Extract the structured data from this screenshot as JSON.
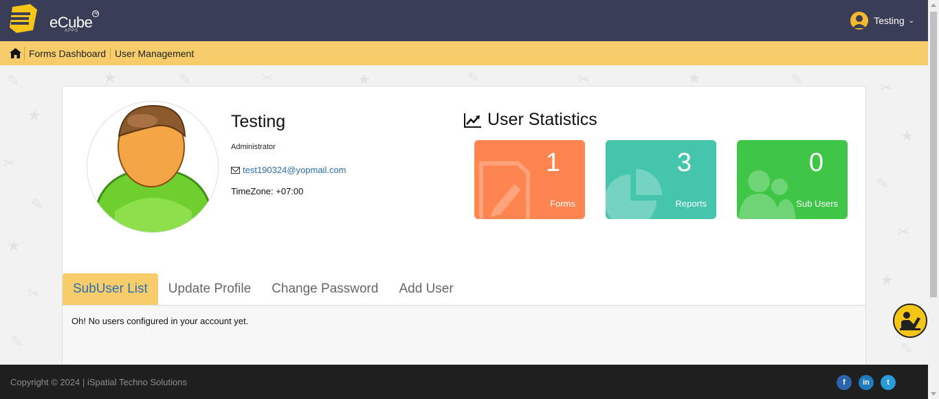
{
  "header": {
    "logo_text": "eCube",
    "logo_sub": "APPS",
    "logo_tm": "TM",
    "user_name": "Testing"
  },
  "nav": {
    "items": [
      {
        "label": "Forms Dashboard"
      },
      {
        "label": "User Management"
      }
    ]
  },
  "profile": {
    "name": "Testing",
    "role": "Administrator",
    "email": "test190324@yopmail.com",
    "timezone": "TimeZone: +07:00"
  },
  "stats": {
    "title": "User Statistics",
    "cards": [
      {
        "value": "1",
        "label": "Forms",
        "color": "#fe854f"
      },
      {
        "value": "3",
        "label": "Reports",
        "color": "#45c6ac"
      },
      {
        "value": "0",
        "label": "Sub Users",
        "color": "#3fc647"
      }
    ]
  },
  "tabs": [
    {
      "label": "SubUser List"
    },
    {
      "label": "Update Profile"
    },
    {
      "label": "Change Password"
    },
    {
      "label": "Add User"
    }
  ],
  "tab_content": {
    "empty_message": "Oh! No users configured in your account yet."
  },
  "footer": {
    "copyright": "Copyright © 2024 | iSpatial Techno Solutions",
    "social": [
      {
        "label": "f",
        "icon": "facebook-icon"
      },
      {
        "label": "in",
        "icon": "linkedin-icon"
      },
      {
        "label": "t",
        "icon": "twitter-icon"
      }
    ]
  },
  "colors": {
    "header_bg": "#3a3d56",
    "nav_bg": "#f7cc6a",
    "link": "#2a6fb3",
    "footer_bg": "#1f1f1f"
  }
}
